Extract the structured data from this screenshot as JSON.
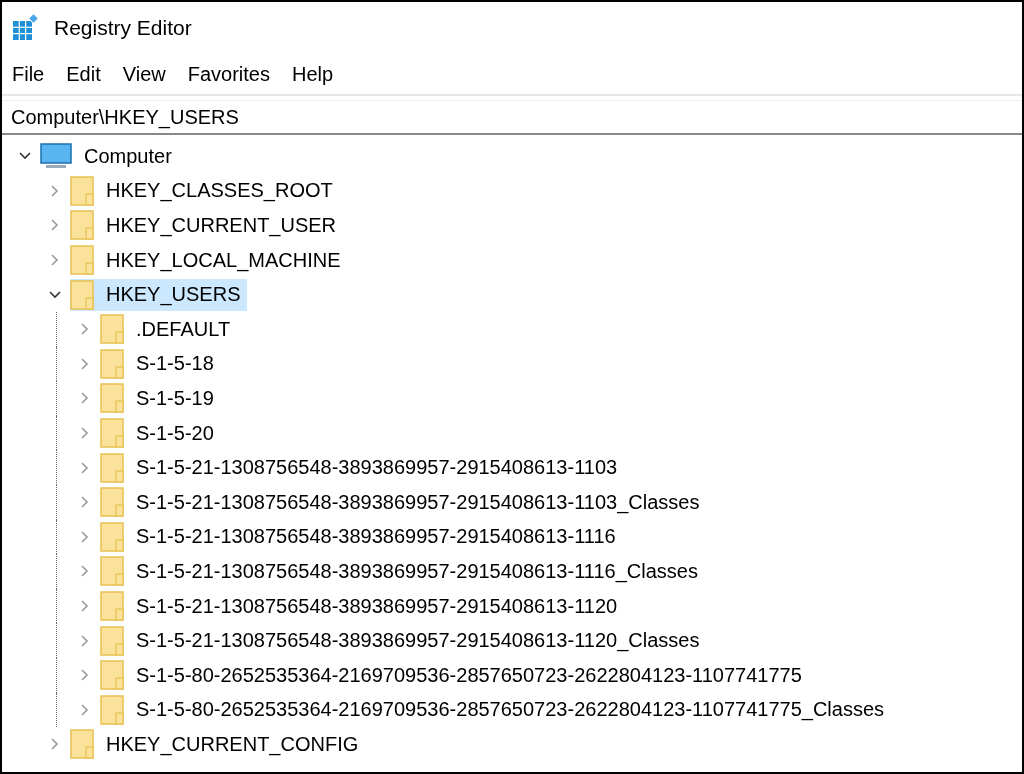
{
  "window": {
    "title": "Registry Editor"
  },
  "menu": [
    "File",
    "Edit",
    "View",
    "Favorites",
    "Help"
  ],
  "address": {
    "value": "Computer\\HKEY_USERS"
  },
  "tree": [
    {
      "label": "Computer",
      "kind": "computer",
      "expanded": true,
      "selected": false,
      "children": [
        {
          "label": "HKEY_CLASSES_ROOT",
          "kind": "folder",
          "expanded": false,
          "selected": false
        },
        {
          "label": "HKEY_CURRENT_USER",
          "kind": "folder",
          "expanded": false,
          "selected": false
        },
        {
          "label": "HKEY_LOCAL_MACHINE",
          "kind": "folder",
          "expanded": false,
          "selected": false
        },
        {
          "label": "HKEY_USERS",
          "kind": "folder",
          "expanded": true,
          "selected": true,
          "children": [
            {
              "label": ".DEFAULT",
              "kind": "folder",
              "expanded": false,
              "selected": false
            },
            {
              "label": "S-1-5-18",
              "kind": "folder",
              "expanded": false,
              "selected": false
            },
            {
              "label": "S-1-5-19",
              "kind": "folder",
              "expanded": false,
              "selected": false
            },
            {
              "label": "S-1-5-20",
              "kind": "folder",
              "expanded": false,
              "selected": false
            },
            {
              "label": "S-1-5-21-1308756548-3893869957-2915408613-1103",
              "kind": "folder",
              "expanded": false,
              "selected": false
            },
            {
              "label": "S-1-5-21-1308756548-3893869957-2915408613-1103_Classes",
              "kind": "folder",
              "expanded": false,
              "selected": false
            },
            {
              "label": "S-1-5-21-1308756548-3893869957-2915408613-1116",
              "kind": "folder",
              "expanded": false,
              "selected": false
            },
            {
              "label": "S-1-5-21-1308756548-3893869957-2915408613-1116_Classes",
              "kind": "folder",
              "expanded": false,
              "selected": false
            },
            {
              "label": "S-1-5-21-1308756548-3893869957-2915408613-1120",
              "kind": "folder",
              "expanded": false,
              "selected": false
            },
            {
              "label": "S-1-5-21-1308756548-3893869957-2915408613-1120_Classes",
              "kind": "folder",
              "expanded": false,
              "selected": false
            },
            {
              "label": "S-1-5-80-2652535364-2169709536-2857650723-2622804123-1107741775",
              "kind": "folder",
              "expanded": false,
              "selected": false
            },
            {
              "label": "S-1-5-80-2652535364-2169709536-2857650723-2622804123-1107741775_Classes",
              "kind": "folder",
              "expanded": false,
              "selected": false
            }
          ]
        },
        {
          "label": "HKEY_CURRENT_CONFIG",
          "kind": "folder",
          "expanded": false,
          "selected": false
        }
      ]
    }
  ]
}
